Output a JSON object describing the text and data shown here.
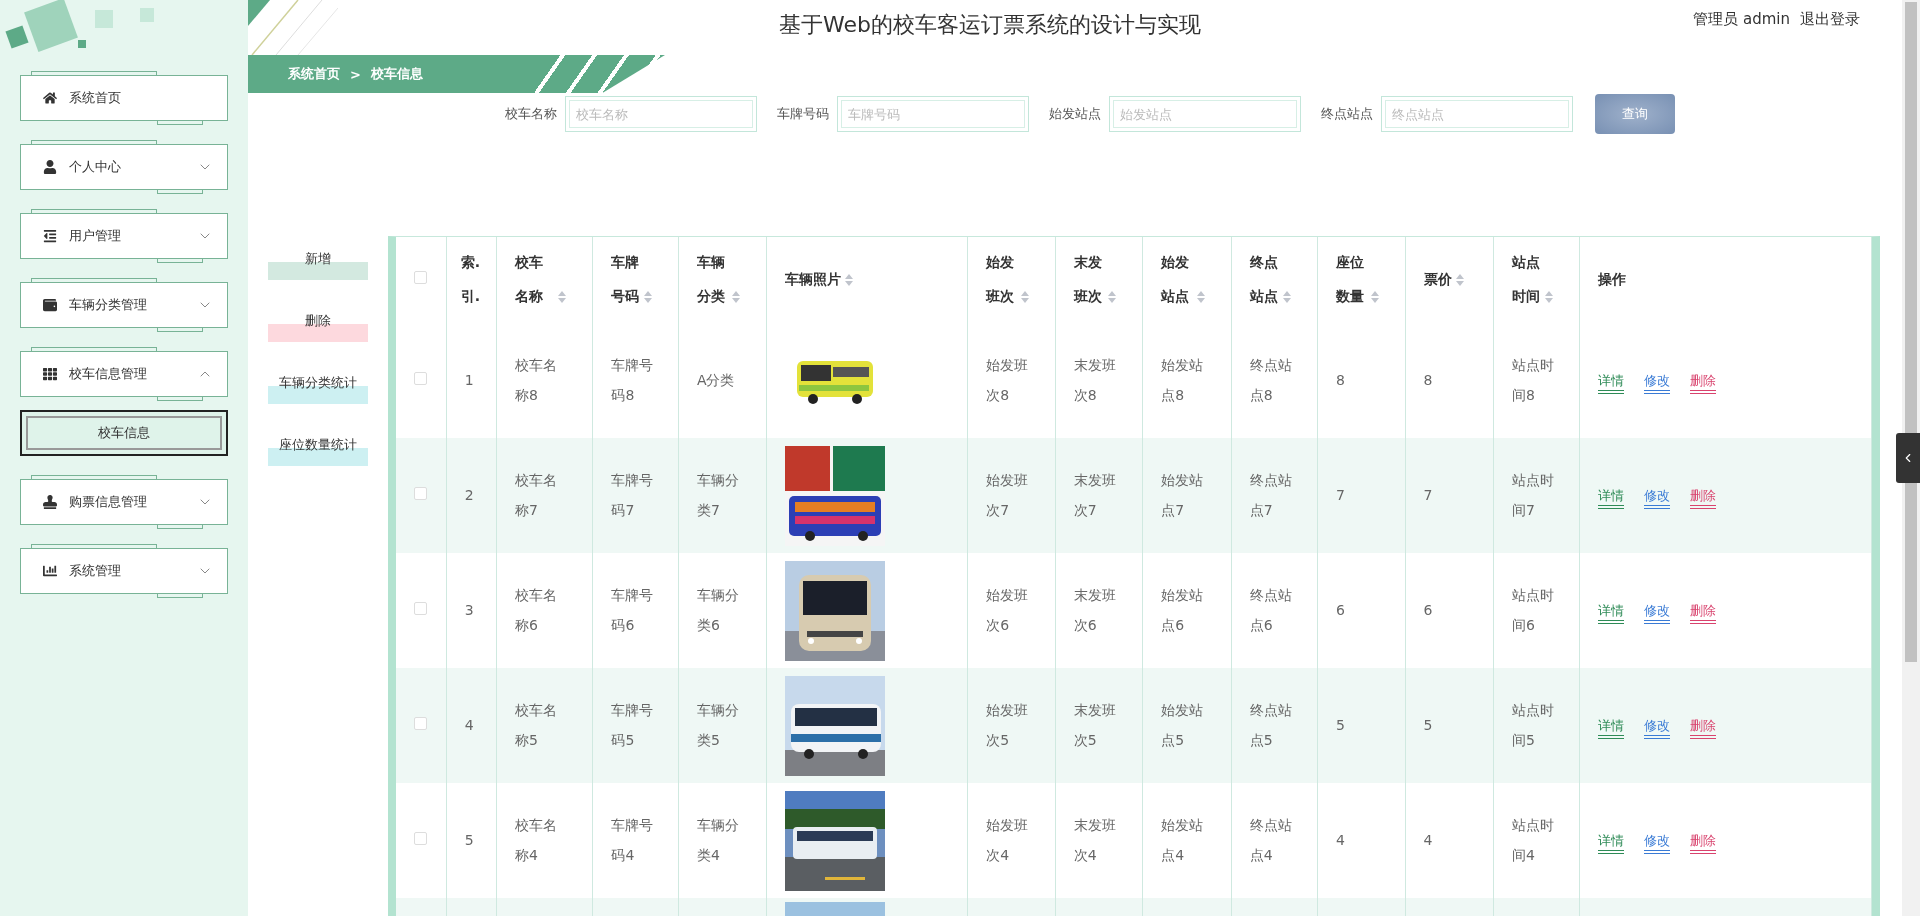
{
  "header": {
    "title": "基于Web的校车客运订票系统的设计与实现",
    "user": "管理员 admin",
    "logout": "退出登录"
  },
  "sidebar": {
    "items": [
      {
        "label": "系统首页",
        "kind": "link"
      },
      {
        "label": "个人中心",
        "kind": "menu",
        "expanded": false
      },
      {
        "label": "用户管理",
        "kind": "menu",
        "expanded": false
      },
      {
        "label": "车辆分类管理",
        "kind": "menu",
        "expanded": false
      },
      {
        "label": "校车信息管理",
        "kind": "menu",
        "expanded": true,
        "children": [
          {
            "label": "校车信息",
            "selected": true
          }
        ]
      },
      {
        "label": "购票信息管理",
        "kind": "menu",
        "expanded": false
      },
      {
        "label": "系统管理",
        "kind": "menu",
        "expanded": false
      }
    ]
  },
  "breadcrumb": {
    "home": "系统首页",
    "separator": ">",
    "current": "校车信息"
  },
  "search": {
    "fields": [
      {
        "label": "校车名称",
        "placeholder": "校车名称"
      },
      {
        "label": "车牌号码",
        "placeholder": "车牌号码"
      },
      {
        "label": "始发站点",
        "placeholder": "始发站点"
      },
      {
        "label": "终点站点",
        "placeholder": "终点站点"
      }
    ],
    "button": "查询"
  },
  "actions": [
    {
      "label": "新增",
      "color": "#d3e9e0"
    },
    {
      "label": "删除",
      "color": "#fdd9de"
    },
    {
      "label": "车辆分类统计",
      "color": "#cdf0f2"
    },
    {
      "label": "座位数量统计",
      "color": "#cdf0f2"
    }
  ],
  "table": {
    "select_all": {
      "checked": false
    },
    "columns": [
      {
        "label": "索.引.",
        "sortable": false
      },
      {
        "label": "校车名称",
        "sortable": true
      },
      {
        "label": "车牌号码",
        "sortable": true
      },
      {
        "label": "车辆分类",
        "sortable": true
      },
      {
        "label": "车辆照片",
        "sortable": true
      },
      {
        "label": "始发班次",
        "sortable": true
      },
      {
        "label": "末发班次",
        "sortable": true
      },
      {
        "label": "始发站点",
        "sortable": true
      },
      {
        "label": "终点站点",
        "sortable": true
      },
      {
        "label": "座位数量",
        "sortable": true
      },
      {
        "label": "票价",
        "sortable": true
      },
      {
        "label": "站点时间",
        "sortable": true
      },
      {
        "label": "操作",
        "sortable": false
      }
    ],
    "rows": [
      {
        "checked": false,
        "cells": [
          "1",
          "校车名称8",
          "车牌号码8",
          "A分类",
          null,
          "始发班次8",
          "末发班次8",
          "始发站点8",
          "终点站点8",
          "8",
          "8",
          "站点时间8"
        ],
        "actions": [
          {
            "label": "详情",
            "color": "#2e8b57"
          },
          {
            "label": "修改",
            "color": "#3a7bd5"
          },
          {
            "label": "删除",
            "color": "#d9436e"
          }
        ]
      },
      {
        "checked": false,
        "cells": [
          "2",
          "校车名称7",
          "车牌号码7",
          "车辆分类7",
          null,
          "始发班次7",
          "末发班次7",
          "始发站点7",
          "终点站点7",
          "7",
          "7",
          "站点时间7"
        ],
        "actions": [
          {
            "label": "详情",
            "color": "#2e8b57"
          },
          {
            "label": "修改",
            "color": "#3a7bd5"
          },
          {
            "label": "删除",
            "color": "#d9436e"
          }
        ]
      },
      {
        "checked": false,
        "cells": [
          "3",
          "校车名称6",
          "车牌号码6",
          "车辆分类6",
          null,
          "始发班次6",
          "末发班次6",
          "始发站点6",
          "终点站点6",
          "6",
          "6",
          "站点时间6"
        ],
        "actions": [
          {
            "label": "详情",
            "color": "#2e8b57"
          },
          {
            "label": "修改",
            "color": "#3a7bd5"
          },
          {
            "label": "删除",
            "color": "#d9436e"
          }
        ]
      },
      {
        "checked": false,
        "cells": [
          "4",
          "校车名称5",
          "车牌号码5",
          "车辆分类5",
          null,
          "始发班次5",
          "末发班次5",
          "始发站点5",
          "终点站点5",
          "5",
          "5",
          "站点时间5"
        ],
        "actions": [
          {
            "label": "详情",
            "color": "#2e8b57"
          },
          {
            "label": "修改",
            "color": "#3a7bd5"
          },
          {
            "label": "删除",
            "color": "#d9436e"
          }
        ]
      },
      {
        "checked": false,
        "cells": [
          "5",
          "校车名称4",
          "车牌号码4",
          "车辆分类4",
          null,
          "始发班次4",
          "末发班次4",
          "始发站点4",
          "终点站点4",
          "4",
          "4",
          "站点时间4"
        ],
        "actions": [
          {
            "label": "详情",
            "color": "#2e8b57"
          },
          {
            "label": "修改",
            "color": "#3a7bd5"
          },
          {
            "label": "删除",
            "color": "#d9436e"
          }
        ]
      }
    ]
  }
}
